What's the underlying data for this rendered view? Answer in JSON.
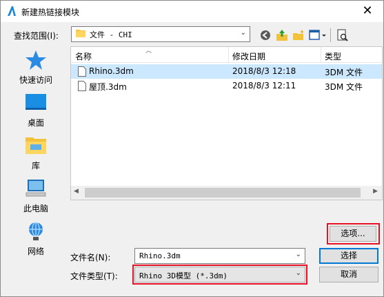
{
  "window": {
    "title": "新建热链接模块",
    "close_glyph": "✕"
  },
  "toolbar": {
    "lookin_label": "查找范围(I):",
    "lookin_value": "文件 - CHI",
    "buttons": [
      "back-icon",
      "up-folder-icon",
      "new-folder-icon",
      "view-menu-icon",
      "preview-icon"
    ]
  },
  "places": [
    {
      "label": "快速访问",
      "icon": "star-icon"
    },
    {
      "label": "桌面",
      "icon": "desktop-icon"
    },
    {
      "label": "库",
      "icon": "library-icon"
    },
    {
      "label": "此电脑",
      "icon": "computer-icon"
    },
    {
      "label": "网络",
      "icon": "network-icon"
    }
  ],
  "filelist": {
    "columns": [
      "名称",
      "修改日期",
      "类型"
    ],
    "rows": [
      {
        "name": "Rhino.3dm",
        "date": "2018/8/3 12:18",
        "type": "3DM 文件",
        "selected": true
      },
      {
        "name": "屋顶.3dm",
        "date": "2018/8/3 12:11",
        "type": "3DM 文件",
        "selected": false
      }
    ]
  },
  "options_label": "选项...",
  "filename": {
    "label": "文件名(N):",
    "value": "Rhino.3dm"
  },
  "filetype": {
    "label": "文件类型(T):",
    "value": "Rhino 3D模型 (*.3dm)"
  },
  "open_label": "选择",
  "cancel_label": "取消",
  "colors": {
    "highlight": "#e81123",
    "selection": "#cce8ff",
    "accent": "#0078d7"
  }
}
